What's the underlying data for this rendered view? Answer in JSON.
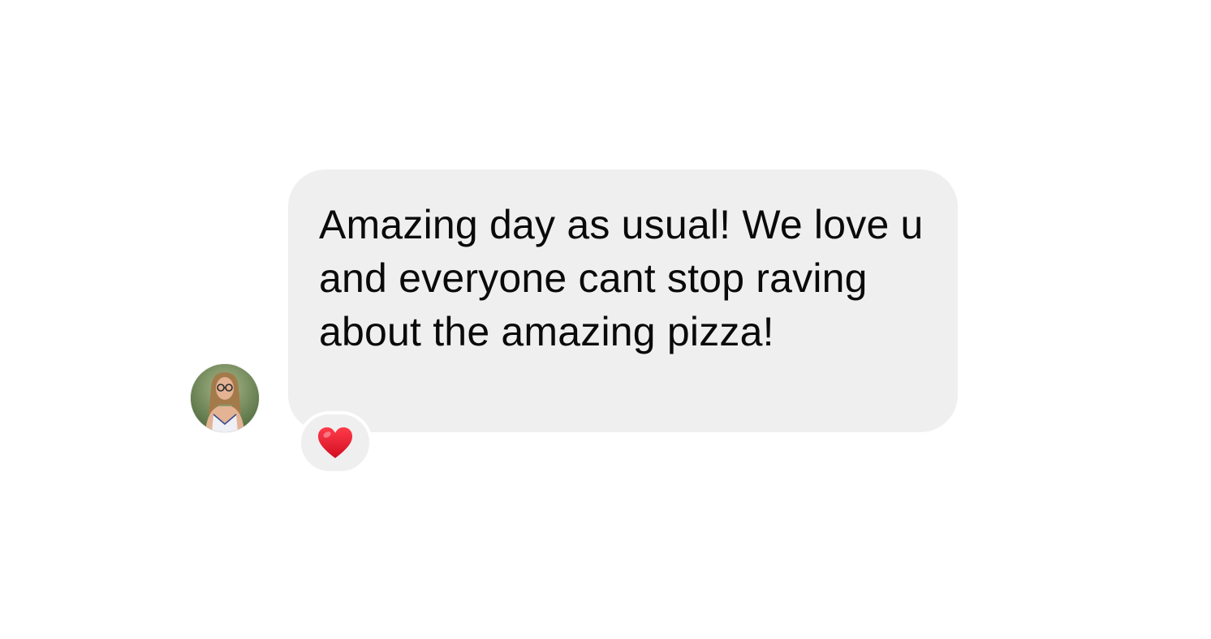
{
  "message": {
    "text": "Amazing day as usual! We love u and everyone cant stop raving about the amazing pizza!",
    "bubble_color": "#efefef",
    "text_color": "#0a0a0a"
  },
  "reaction": {
    "icon": "red-heart-icon",
    "color": "#e0162b"
  },
  "sender": {
    "avatar_icon": "profile-photo"
  }
}
